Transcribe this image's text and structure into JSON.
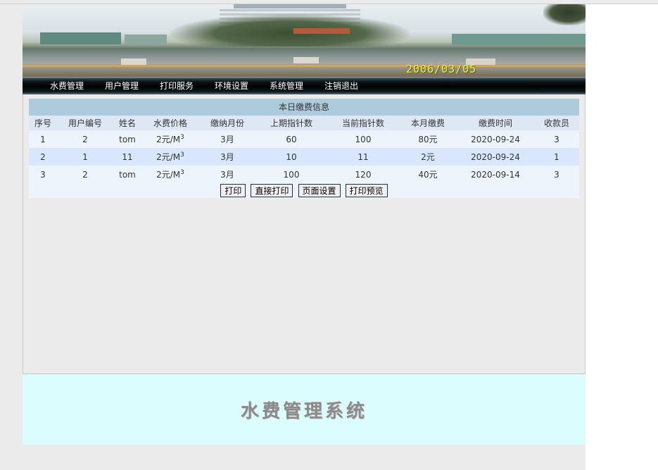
{
  "banner": {
    "date_stamp": "2006/03/05"
  },
  "nav": {
    "items": [
      "水费管理",
      "用户管理",
      "打印服务",
      "环境设置",
      "系统管理",
      "注销退出"
    ]
  },
  "table": {
    "caption": "本日缴费信息",
    "headers": [
      "序号",
      "用户编号",
      "姓名",
      "水费价格",
      "缴纳月份",
      "上期指针数",
      "当前指针数",
      "本月缴费",
      "缴费时间",
      "收款员"
    ],
    "rows": [
      {
        "id": "1",
        "user_no": "2",
        "name": "tom",
        "price": "2元/M",
        "price_sup": "3",
        "month": "3月",
        "prev": "60",
        "curr": "100",
        "fee": "80元",
        "time": "2020-09-24",
        "cashier": "3"
      },
      {
        "id": "2",
        "user_no": "1",
        "name": "11",
        "price": "2元/M",
        "price_sup": "3",
        "month": "3月",
        "prev": "10",
        "curr": "11",
        "fee": "2元",
        "time": "2020-09-24",
        "cashier": "1"
      },
      {
        "id": "3",
        "user_no": "2",
        "name": "tom",
        "price": "2元/M",
        "price_sup": "3",
        "month": "3月",
        "prev": "100",
        "curr": "120",
        "fee": "40元",
        "time": "2020-09-14",
        "cashier": "3"
      }
    ]
  },
  "buttons": {
    "print": "打印",
    "direct_print": "直接打印",
    "page_setup": "页面设置",
    "print_preview": "打印预览"
  },
  "footer": {
    "system_name": "水费管理系统"
  }
}
